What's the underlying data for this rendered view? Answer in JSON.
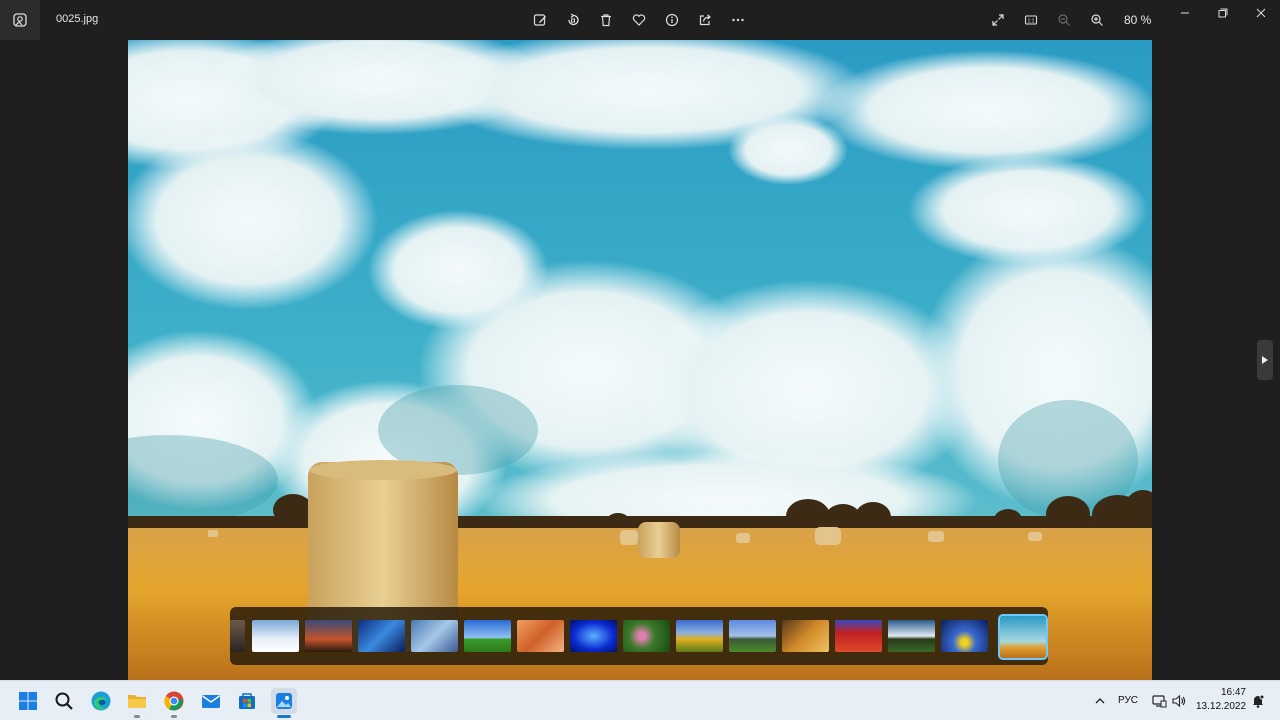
{
  "titlebar": {
    "file_name": "0025.jpg",
    "zoom_label": "80 %"
  },
  "toolbar": {
    "icons": [
      "edit-icon",
      "rotate-icon",
      "delete-icon",
      "favorite-icon",
      "info-icon",
      "share-icon",
      "more-icon"
    ]
  },
  "right_tools": {
    "icons": [
      "fullscreen-icon",
      "actual-size-icon",
      "zoom-out-icon",
      "zoom-in-icon"
    ]
  },
  "window_controls": [
    "minimize",
    "maximize",
    "close"
  ],
  "filmstrip": {
    "thumbnail_count": 16,
    "active_index": 15
  },
  "taskbar": {
    "apps": [
      "start",
      "search",
      "edge",
      "file-explorer",
      "chrome",
      "mail",
      "store",
      "photos"
    ],
    "language": "РУС",
    "time": "16:47",
    "date": "13.12.2022"
  },
  "colors": {
    "titlebar_bg": "#1f1f1f",
    "taskbar_bg": "#e8eef6",
    "accent": "#1976d2",
    "filmstrip_highlight": "#6fc7ff"
  }
}
